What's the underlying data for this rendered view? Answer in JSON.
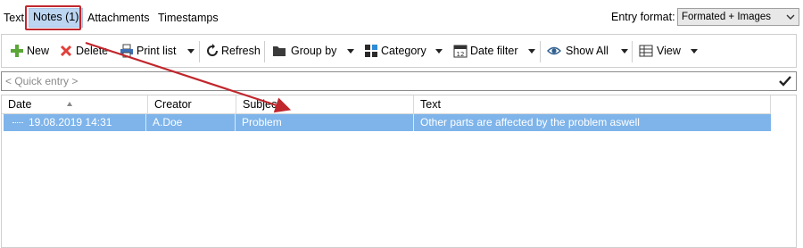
{
  "tabs": [
    {
      "label": "Text"
    },
    {
      "label": "Notes (1)"
    },
    {
      "label": "Attachments"
    },
    {
      "label": "Timestamps"
    }
  ],
  "entry_format": {
    "label": "Entry format:",
    "value": "Formated + Images"
  },
  "toolbar": {
    "new": "New",
    "delete": "Delete",
    "print_list": "Print list",
    "refresh": "Refresh",
    "group_by": "Group by",
    "category": "Category",
    "date_filter": "Date filter",
    "show_all": "Show All",
    "view": "View"
  },
  "quick_entry": {
    "placeholder": "< Quick entry >"
  },
  "grid": {
    "columns": [
      "Date",
      "Creator",
      "Subject",
      "Text"
    ],
    "rows": [
      {
        "date": "19.08.2019 14:31",
        "creator": "A.Doe",
        "subject": "Problem",
        "text": "Other parts are affected by the problem aswell"
      }
    ]
  },
  "colors": {
    "selection": "#7eb4ea",
    "active_tab": "#bcd6f2",
    "annotation_red": "#c0272d"
  }
}
